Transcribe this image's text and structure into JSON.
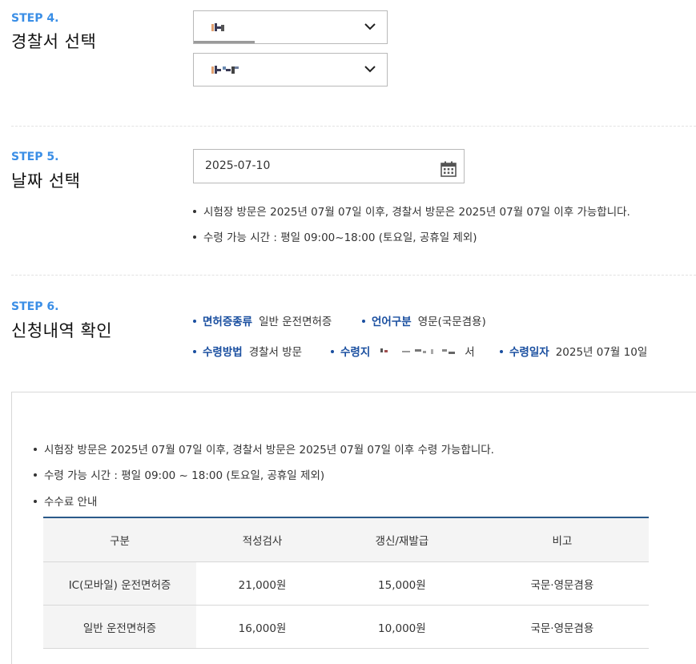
{
  "step4": {
    "label": "STEP 4.",
    "title": "경찰서 선택"
  },
  "step5": {
    "label": "STEP 5.",
    "title": "날짜 선택",
    "date_value": "2025-07-10",
    "notes": [
      "시험장 방문은 2025년 07월 07일 이후, 경찰서 방문은 2025년 07월 07일 이후 가능합니다.",
      "수령 가능 시간 : 평일 09:00~18:00 (토요일, 공휴일 제외)"
    ]
  },
  "step6": {
    "label": "STEP 6.",
    "title": "신청내역 확인",
    "items": {
      "license_type": {
        "key": "면허증종류",
        "value": "일반 운전면허증"
      },
      "language": {
        "key": "언어구분",
        "value": "영문(국문겸용)"
      },
      "method": {
        "key": "수령방법",
        "value": "경찰서 방문"
      },
      "place": {
        "key": "수령지",
        "value_suffix": "서"
      },
      "date": {
        "key": "수령일자",
        "value": "2025년 07월 10일"
      }
    }
  },
  "notice": {
    "lines": [
      "시험장 방문은 2025년 07월 07일 이후, 경찰서 방문은 2025년 07월 07일 이후 수령 가능합니다.",
      "수령 가능 시간 : 평일 09:00 ~ 18:00 (토요일, 공휴일 제외)",
      "수수료 안내"
    ]
  },
  "fee_table": {
    "headers": [
      "구분",
      "적성검사",
      "갱신/재발급",
      "비고"
    ],
    "rows": [
      [
        "IC(모바일) 운전면허증",
        "21,000원",
        "15,000원",
        "국문·영문겸용"
      ],
      [
        "일반 운전면허증",
        "16,000원",
        "10,000원",
        "국문·영문겸용"
      ]
    ]
  },
  "colors": {
    "accent": "#3a8ee6",
    "key_blue": "#1a4fa0",
    "table_border": "#2a5a8a"
  }
}
